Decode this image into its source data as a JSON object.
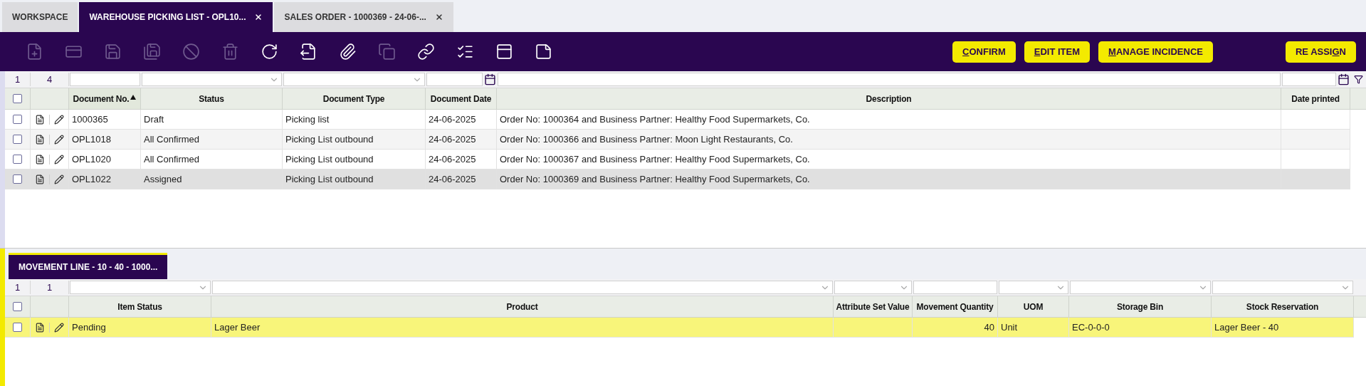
{
  "tabs": [
    {
      "label": "WORKSPACE",
      "selected": false,
      "closable": false
    },
    {
      "label": "WAREHOUSE PICKING LIST - OPL10...",
      "selected": true,
      "closable": true
    },
    {
      "label": "SALES ORDER - 1000369 - 24-06-...",
      "selected": false,
      "closable": true
    }
  ],
  "toolbar": {
    "icons": [
      {
        "disabled": true
      },
      {
        "disabled": true
      },
      {
        "disabled": true
      },
      {
        "disabled": true
      },
      {
        "disabled": true
      },
      {
        "disabled": true
      },
      {
        "disabled": false
      },
      {
        "disabled": false
      },
      {
        "disabled": false
      },
      {
        "disabled": true
      },
      {
        "disabled": false
      },
      {
        "disabled": false
      },
      {
        "disabled": false
      },
      {
        "disabled": false
      }
    ],
    "buttons": [
      {
        "parts": [
          {
            "text": "C",
            "underlined": true
          },
          {
            "text": "ONFIRM",
            "underlined": false
          }
        ]
      },
      {
        "parts": [
          {
            "text": "E",
            "underlined": true
          },
          {
            "text": "DIT ITEM",
            "underlined": false
          }
        ]
      },
      {
        "parts": [
          {
            "text": "M",
            "underlined": true
          },
          {
            "text": "ANAGE INCIDENCE",
            "underlined": false
          }
        ]
      }
    ],
    "right_buttons": [
      {
        "parts": [
          {
            "text": "RE ASSI",
            "underlined": false
          },
          {
            "text": "G",
            "underlined": true
          },
          {
            "text": "N",
            "underlined": false
          }
        ]
      }
    ]
  },
  "header_grid": {
    "focused": false,
    "all_checked": false,
    "counts": [
      "1",
      "4"
    ],
    "columns": [
      {
        "label": "Document No.",
        "sorted_ascending": true,
        "kind": "text"
      },
      {
        "label": "Status",
        "sorted_ascending": false,
        "kind": "select"
      },
      {
        "label": "Document Type",
        "sorted_ascending": false,
        "kind": "select"
      },
      {
        "label": "Document Date",
        "sorted_ascending": false,
        "kind": "date"
      },
      {
        "label": "Description",
        "sorted_ascending": false,
        "kind": "text"
      },
      {
        "label": "Date printed",
        "sorted_ascending": false,
        "kind": "date"
      }
    ],
    "rows": [
      {
        "selected": false,
        "checked": false,
        "cells": [
          "1000365",
          "Draft",
          "Picking list",
          "24-06-2025",
          "Order No: 1000364 and Business Partner: Healthy Food Supermarkets, Co.",
          ""
        ]
      },
      {
        "selected": false,
        "checked": false,
        "cells": [
          "OPL1018",
          "All Confirmed",
          "Picking List outbound",
          "24-06-2025",
          "Order No: 1000366 and Business Partner: Moon Light Restaurants, Co.",
          ""
        ]
      },
      {
        "selected": false,
        "checked": false,
        "cells": [
          "OPL1020",
          "All Confirmed",
          "Picking List outbound",
          "24-06-2025",
          "Order No: 1000367 and Business Partner: Healthy Food Supermarkets, Co.",
          ""
        ]
      },
      {
        "selected": true,
        "checked": false,
        "cells": [
          "OPL1022",
          "Assigned",
          "Picking List outbound",
          "24-06-2025",
          "Order No: 1000369 and Business Partner: Healthy Food Supermarkets, Co.",
          ""
        ]
      }
    ]
  },
  "line_tab": {
    "label": "MOVEMENT LINE - 10 - 40 - 1000..."
  },
  "line_grid": {
    "focused": true,
    "all_checked": false,
    "counts": [
      "1",
      "1"
    ],
    "columns": [
      {
        "label": "Item Status",
        "kind": "select"
      },
      {
        "label": "Product",
        "kind": "select"
      },
      {
        "label": "Attribute Set Value",
        "kind": "select"
      },
      {
        "label": "Movement Quantity",
        "kind": "text"
      },
      {
        "label": "UOM",
        "kind": "select"
      },
      {
        "label": "Storage Bin",
        "kind": "select"
      },
      {
        "label": "Stock Reservation",
        "kind": "select"
      }
    ],
    "rows": [
      {
        "selected": true,
        "checked": false,
        "cells": [
          "Pending",
          "Lager Beer",
          "",
          "40",
          "Unit",
          "EC-0-0-0",
          "Lager Beer - 40"
        ]
      }
    ]
  }
}
